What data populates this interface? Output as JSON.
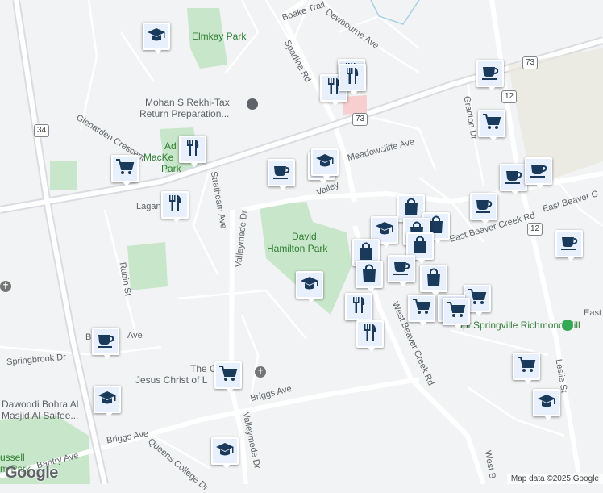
{
  "map": {
    "colors": {
      "background": "#f1f3f4",
      "park": "#c8e6c9",
      "road_major": "#ffffff",
      "road_highway": "#dadce0",
      "marker_bg": "#e8f0fe",
      "marker_icon": "#1a3a5c",
      "park_text": "#2e7d32"
    },
    "road_labels": {
      "boake_trail": "Boake Trail",
      "dewbourne_ave": "Dewbourne Ave",
      "spadina_rd": "Spadina Rd",
      "glenarden_crescent": "Glenarden Crescent",
      "meadowcliffe_ave": "Meadowcliffe Ave",
      "valleymede_dr_1": "Valley",
      "valleymede_dr_2": "Valleymede Dr",
      "valleymede_dr_3": "Valleymede Dr",
      "stratheam_ave": "Stratheam Ave",
      "laganl": "Lagan",
      "rubin_st": "Rubin St",
      "east_beaver_creek_rd_1": "East Beaver C",
      "east_beaver_creek_rd_2": "East Beaver Creek Rd",
      "west_beaver_creek_rd_1": "West Beaver Creek Rd",
      "west_beaver_creek_rd_2": "West B",
      "granton_dr": "Granton Dr",
      "springbrook_dr": "Springbrook Dr",
      "b_ave": "B",
      "ave_fragment": "Ave",
      "briggs_ave_1": "Briggs Ave",
      "briggs_ave_2": "Briggs Ave",
      "bantry_ave": "Bantry Ave",
      "queens_college_dr": "Queens College Dr",
      "leslie_st": "Leslie St",
      "east_fragment": "East"
    },
    "highway_shields": {
      "h34": "34",
      "h73_top": "73",
      "h73_mid": "73",
      "h12_top": "12",
      "h12_mid": "12"
    },
    "place_labels": {
      "elmkay_park": "Elmkay Park",
      "mohan": "Mohan S Rekhi-Tax",
      "mohan_2": "Return Preparation...",
      "adams_mackenzie_1": "Ad",
      "adams_mackenzie_2": "MacKe",
      "adams_mackenzie_3": "Park",
      "david_hamilton_1": "David",
      "david_hamilton_2": "Hamilton Park",
      "springville": "Springville Richmond Hill",
      "church_jesus_1": "The Ch",
      "church_jesus_2": "Jesus Christ of L",
      "dawoodi_1": "Dawoodi Bohra Al",
      "dawoodi_2": "Masjid Al Saifee...",
      "russell_1": "ussell",
      "russell_2": "m Park",
      "springville_prefix": "Spr"
    },
    "markers": [
      {
        "type": "school-icon"
      },
      {
        "type": "restaurant-icon"
      },
      {
        "type": "restaurant-icon"
      },
      {
        "type": "restaurant-icon"
      },
      {
        "type": "cafe-icon"
      },
      {
        "type": "restaurant-icon"
      },
      {
        "type": "grocery-icon"
      },
      {
        "type": "grocery-icon"
      },
      {
        "type": "cafe-icon"
      },
      {
        "type": "school-icon"
      },
      {
        "type": "school-icon"
      },
      {
        "type": "cafe-icon"
      },
      {
        "type": "cafe-icon"
      },
      {
        "type": "restaurant-icon"
      },
      {
        "type": "shopping-icon"
      },
      {
        "type": "cafe-icon"
      },
      {
        "type": "shopping-icon"
      },
      {
        "type": "school-icon"
      },
      {
        "type": "shopping-icon"
      },
      {
        "type": "shopping-icon"
      },
      {
        "type": "shopping-icon"
      },
      {
        "type": "cafe-icon"
      },
      {
        "type": "cafe-icon"
      },
      {
        "type": "shopping-icon"
      },
      {
        "type": "school-icon"
      },
      {
        "type": "shopping-icon"
      },
      {
        "type": "grocery-icon"
      },
      {
        "type": "restaurant-icon"
      },
      {
        "type": "grocery-icon"
      },
      {
        "type": "grocery-icon"
      },
      {
        "type": "grocery-icon"
      },
      {
        "type": "restaurant-icon"
      },
      {
        "type": "cafe-icon"
      },
      {
        "type": "grocery-icon"
      },
      {
        "type": "grocery-icon"
      },
      {
        "type": "school-icon"
      },
      {
        "type": "school-icon"
      },
      {
        "type": "school-icon"
      }
    ],
    "footer": {
      "logo": "Google",
      "attribution": "Map data ©2025 Google"
    }
  }
}
